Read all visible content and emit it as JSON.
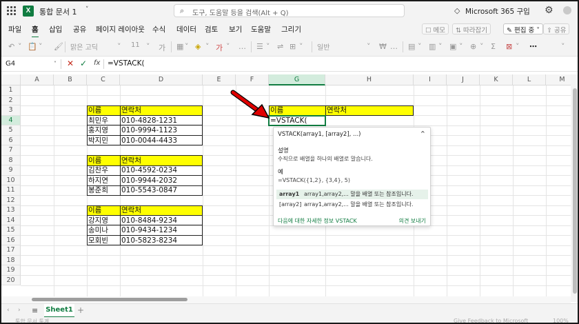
{
  "window": {
    "doc_title": "통합 문서 1",
    "search_placeholder": "도구, 도움말 등을 검색(Alt + Q)",
    "account": "Microsoft 365 구입"
  },
  "menu": {
    "tabs": [
      "파일",
      "홈",
      "삽입",
      "공유",
      "페이지 레이아웃",
      "수식",
      "데이터",
      "검토",
      "보기",
      "도움말",
      "그리기"
    ],
    "active_tab": "홈",
    "memo_label": "메모",
    "catchup_label": "따라잡기",
    "edit_label": "편집 중",
    "share_label": "공유"
  },
  "ribbon": {
    "font_name": "맑은 고딕",
    "font_size": "11",
    "number_format": "일반"
  },
  "formula_bar": {
    "name_box": "G4",
    "formula": "=VSTACK("
  },
  "columns": [
    "A",
    "B",
    "C",
    "D",
    "E",
    "F",
    "G",
    "H",
    "I",
    "J",
    "K",
    "L",
    "M"
  ],
  "selected_column": "G",
  "rows": [
    "1",
    "2",
    "3",
    "4",
    "5",
    "6",
    "7",
    "8",
    "9",
    "10",
    "11",
    "12",
    "13",
    "14",
    "15",
    "16",
    "17",
    "18",
    "19",
    "20"
  ],
  "selected_row": "4",
  "tables": {
    "t1": {
      "header": [
        "이름",
        "연락처"
      ],
      "rows": [
        [
          "최민우",
          "010-4828-1231"
        ],
        [
          "홍지영",
          "010-9994-1123"
        ],
        [
          "박지민",
          "010-0044-4433"
        ]
      ]
    },
    "t2": {
      "header": [
        "이름",
        "연락처"
      ],
      "rows": [
        [
          "김찬우",
          "010-4592-0234"
        ],
        [
          "하지연",
          "010-9944-2032"
        ],
        [
          "봉준희",
          "010-5543-0847"
        ]
      ]
    },
    "t3": {
      "header": [
        "이름",
        "연락처"
      ],
      "rows": [
        [
          "강지영",
          "010-8484-9234"
        ],
        [
          "송미나",
          "010-9434-1234"
        ],
        [
          "모회빈",
          "010-5823-8234"
        ]
      ]
    },
    "target": {
      "header": [
        "이름",
        "연락처"
      ],
      "active_cell": "=VSTACK("
    }
  },
  "tooltip": {
    "signature": "VSTACK(array1, [array2], ...)",
    "desc_title": "설명",
    "desc": "수직으로 배열을 하나의 배열로 말습니다.",
    "example_title": "예",
    "example": "=VSTACK({1,2}, {3,4}, 5)",
    "params": [
      {
        "name": "array1",
        "desc": "array1,array2,... 말을 배열 또는 참조입니다."
      },
      {
        "name": "[array2]",
        "desc": "array1,array2,... 말을 배열 또는 참조입니다."
      }
    ],
    "more_link": "다음에 대한 자세한 정보 VSTACK",
    "feedback": "의견 보내기"
  },
  "sheets": [
    "Sheet1"
  ],
  "status": {
    "left": "통합 문서 통계",
    "feedback": "Give Feedback to Microsoft",
    "zoom": "100%"
  },
  "colors": {
    "accent": "#107c41",
    "header_fill": "#ffff00",
    "arrow": "#e00000"
  }
}
